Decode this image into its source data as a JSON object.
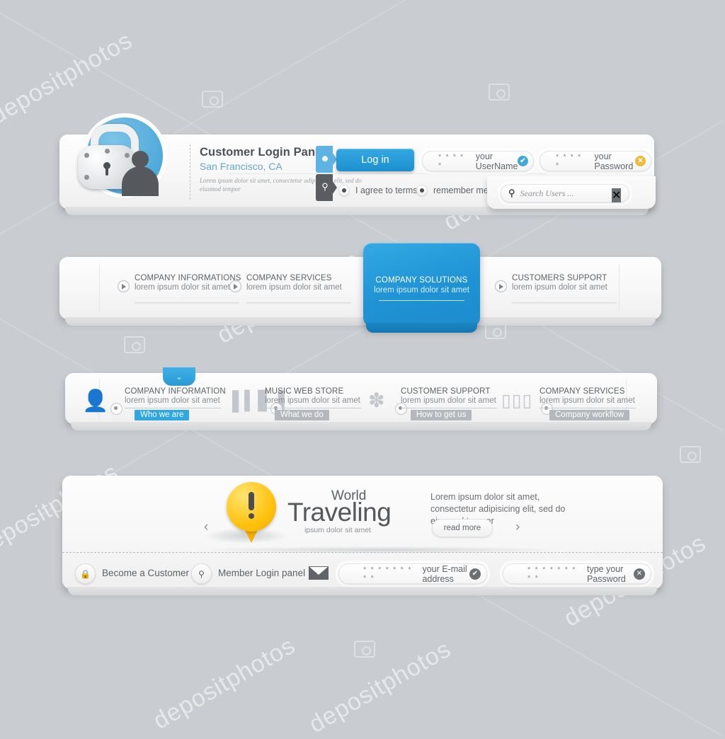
{
  "page": {
    "background_color": "#c9cdd1",
    "watermark_text": "depositphotos",
    "accent_blue": "#2fa7e2",
    "accent_amber": "#f1b93a"
  },
  "login_panel": {
    "name": "Customer Login Panel",
    "title": "Customer Login Panel",
    "subtitle": "San Francisco, CA",
    "lorem": "Lorem ipsum dolor sit amet, consectetur adipisicing elit, sed do eiusmod tempor",
    "login_button": "Log in",
    "username_field": {
      "stars": "* * * * *",
      "label": "your UserName",
      "badge": "✔"
    },
    "password_field": {
      "stars": "* * * * *",
      "label": "your Password",
      "badge": "✕"
    },
    "checkbox_terms": "I agree to terms",
    "checkbox_remember": "remember me",
    "search": {
      "placeholder": "Search Users ...",
      "clear": "✕"
    },
    "tab_user_icon": "user-icon",
    "tab_search_icon": "search-icon",
    "lock_icon": "padlock-icon"
  },
  "solutions_panel": {
    "items": [
      {
        "heading": "COMPANY INFORMATIONS",
        "sub": "lorem ipsum dolor sit amet"
      },
      {
        "heading": "COMPANY SERVICES",
        "sub": "lorem ipsum dolor sit amet"
      },
      {
        "heading": "CUSTOMERS SUPPORT",
        "sub": "lorem ipsum dolor sit amet"
      }
    ],
    "highlight": {
      "heading": "COMPANY SOLUTIONS",
      "sub": "lorem ipsum dolor sit amet"
    }
  },
  "nav_panel": {
    "chevron": "⌄",
    "items": [
      {
        "icon": "user-avatar-icon",
        "heading": "COMPANY INFORMATION",
        "sub": "lorem ipsum dolor sit amet",
        "tag": "Who we are",
        "tag_style": "blue"
      },
      {
        "icon": "bar-chart-icon",
        "heading": "MUSIC WEB STORE",
        "sub": "lorem ipsum dolor sit amet",
        "tag": "What we do",
        "tag_style": "gray"
      },
      {
        "icon": "feather-icon",
        "heading": "CUSTOMER SUPPORT",
        "sub": "lorem ipsum dolor sit amet",
        "tag": "How to get us",
        "tag_style": "gray"
      },
      {
        "icon": "folders-icon",
        "heading": "COMPANY SERVICES",
        "sub": "lorem ipsum dolor sit amet",
        "tag": "Company workflow",
        "tag_style": "gray"
      }
    ]
  },
  "travel_panel": {
    "brand_small": "World",
    "brand_big": "Traveling",
    "brand_tiny": "ipsum dolor sit amet",
    "copy": "Lorem ipsum dolor sit amet, consectetur adipisicing elit, sed do eiusmod tempor",
    "read_more": "read more",
    "prev_arrow": "‹",
    "next_arrow": "›",
    "pin_icon": "map-pin-exclamation-icon",
    "become_customer": {
      "icon": "lock-icon",
      "label": "Become a Customer"
    },
    "member_login": {
      "icon": "key-icon",
      "label": "Member Login panel"
    },
    "mail_icon": "envelope-icon",
    "email_field": {
      "stars": "* * * * * * * * *",
      "label": "your E-mail address",
      "badge": "✔"
    },
    "password_field": {
      "stars": "* * * * * * * * *",
      "label": "type your Password",
      "badge": "✕"
    }
  }
}
